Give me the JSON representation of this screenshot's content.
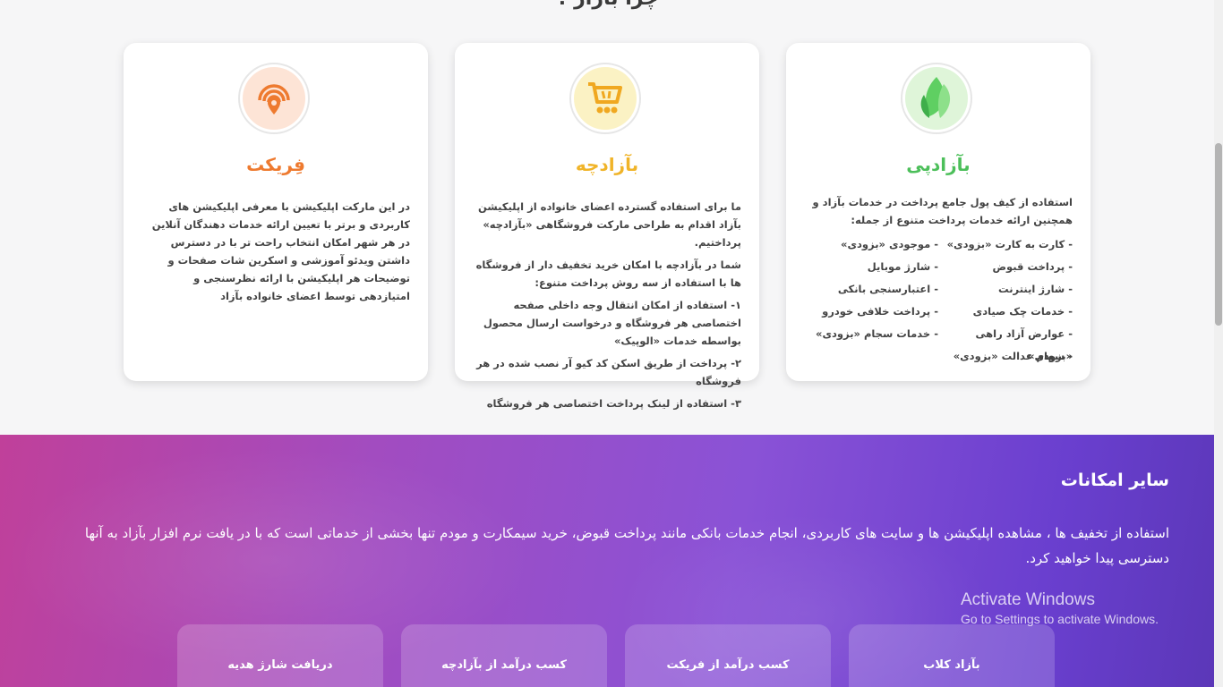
{
  "section": {
    "title": "چرا بازار ؟"
  },
  "cards": [
    {
      "title": "بآزادپی",
      "title_color": "#4cbf5a",
      "intro": "استفاده از کیف پول جامع پرداخت در خدمات بآزاد و همچنین ارائه خدمات پرداخت متنوع از جمله:",
      "services_right": [
        "- کارت به کارت «بزودی»",
        "- پرداخت قبوض",
        "- شارژ اینترنت",
        "- خدمات چک صیادی",
        "- عوارض آزاد راهی «بزودی»",
        "- سهام عدالت «بزودی»"
      ],
      "services_left": [
        "- موجودی «بزودی»",
        "- شارژ موبایل",
        "- اعتبارسنجی بانکی",
        "- پرداخت خلافی خودرو",
        "- خدمات سجام «بزودی»"
      ]
    },
    {
      "title": "بآزادچه",
      "title_color": "#f0b429",
      "paragraphs": [
        "ما برای استفاده گسترده اعضای خانواده از اپلیکیشن بآزاد اقدام به طراحی مارکت فروشگاهی «بآزادچه» پرداختیم.",
        "شما در بآزادچه با امکان خرید تخفیف دار از فروشگاه ها با استفاده از سه روش پرداخت متنوع:",
        "۱- استفاده از امکان انتقال وجه داخلی صفحه اختصاصی هر فروشگاه و درخواست ارسال محصول بواسطه خدمات «الوپیک»",
        "۲- پرداخت از طریق اسکن کد کیو آر نصب شده در هر فروشگاه",
        "۳- استفاده از لینک پرداخت اختصاصی هر فروشگاه"
      ]
    },
    {
      "title": "فِریکت",
      "title_color": "#ee7a2f",
      "paragraphs": [
        "در این مارکت اپلیکیشن با معرفی اپلیکیشن های کاربردی و برتر با تعیین ارائه خدمات دهندگان آنلاین در هر شهر امکان انتخاب راحت تر با در دسترس داشتن ویدئو آموزشی و اسکرین شات صفحات و توضیحات هر اپلیکیشن با ارائه نظرسنجی و امتیازدهی توسط اعضای خانواده بآزاد"
      ]
    }
  ],
  "features": {
    "title": "سایر امکانات",
    "description": "استفاده از تخفیف ها ، مشاهده اپلیکیشن ها و سایت های کاربردی، انجام خدمات بانکی مانند پرداخت قبوض، خرید سیمکارت و مودم تنها بخشی از خدماتی است که با در یافت نرم افزار بآزاد به آنها دسترسی پیدا خواهید کرد.",
    "buttons": [
      "بآزاد کلاب",
      "کسب درآمد از فریکت",
      "کسب درآمد از بآزادچه",
      "دریافت شارژ هدیه"
    ]
  },
  "watermark": {
    "line1": "Activate Windows",
    "line2": "Go to Settings to activate Windows."
  }
}
